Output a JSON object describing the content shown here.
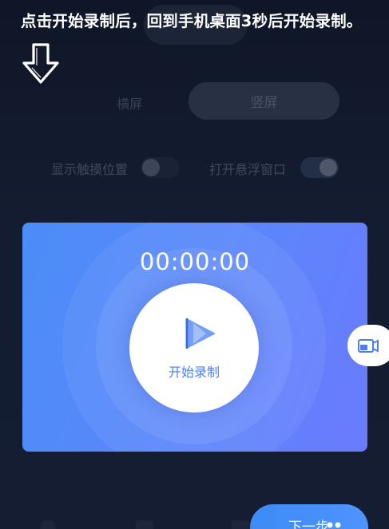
{
  "overlay": {
    "hint": "点击开始录制后，回到手机桌面3秒后开始录制。",
    "arrow_icon": "down-arrow-icon"
  },
  "orientation": {
    "landscape_label": "横屏",
    "portrait_label": "竖屏",
    "selected": "竖屏"
  },
  "options": {
    "show_touch_label": "显示触摸位置",
    "show_touch_on": false,
    "floating_window_label": "打开悬浮窗口",
    "floating_window_on": true
  },
  "record": {
    "timer": "00:00:00",
    "start_label": "开始录制",
    "play_icon": "play-icon",
    "accent": "#4d7df0"
  },
  "float_handle": {
    "icon": "floating-window-icon"
  },
  "footer": {
    "next_label": "下一步",
    "next_color": "#3d8bf5"
  }
}
